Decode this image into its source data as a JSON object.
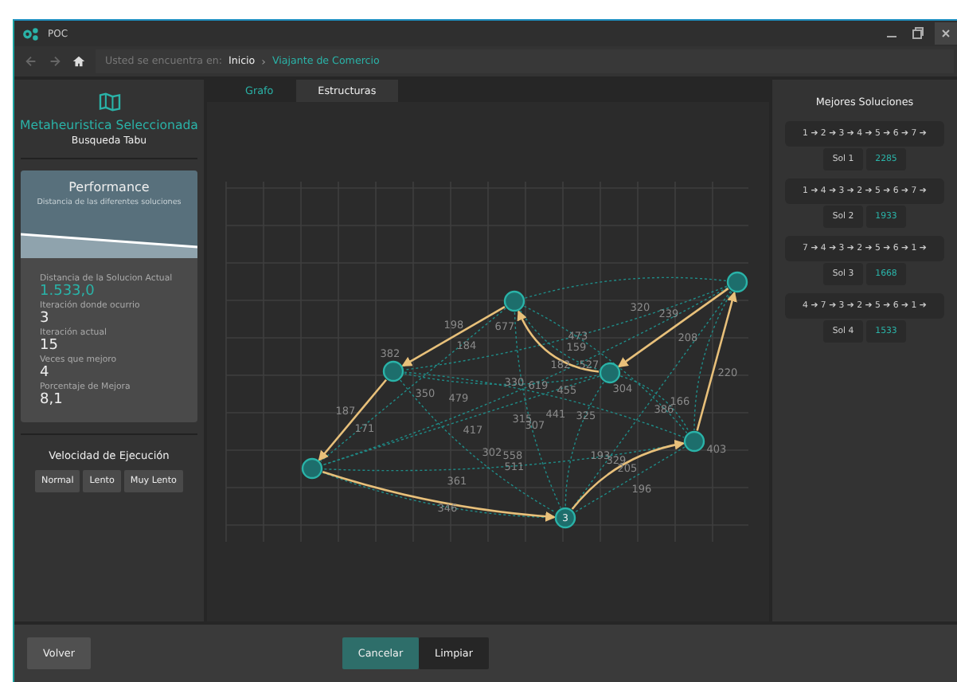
{
  "window": {
    "title": "POC"
  },
  "breadcrumb": {
    "prefix": "Usted se encuentra en:",
    "items": [
      {
        "label": "Inicio",
        "selected": false
      },
      {
        "label": "Viajante de Comercio",
        "selected": true
      }
    ],
    "separator": "›"
  },
  "sidebar": {
    "heading": "Metaheuristica Seleccionada",
    "subheading": "Busqueda Tabu",
    "performance": {
      "title": "Performance",
      "subtitle": "Distancia de las diferentes soluciones",
      "stats": [
        {
          "label": "Distancia de la Solucion Actual",
          "value": "1.533,0",
          "highlight": true
        },
        {
          "label": "Iteración donde ocurrio",
          "value": "3",
          "highlight": false
        },
        {
          "label": "Iteración actual",
          "value": "15",
          "highlight": false
        },
        {
          "label": "Veces que mejoro",
          "value": "4",
          "highlight": false
        },
        {
          "label": "Porcentaje de Mejora",
          "value": "8,1",
          "highlight": false
        }
      ]
    },
    "speed": {
      "title": "Velocidad de Ejecución",
      "buttons": [
        "Normal",
        "Lento",
        "Muy Lento"
      ]
    }
  },
  "tabs": [
    {
      "label": "Grafo",
      "selected": true
    },
    {
      "label": "Estructuras",
      "selected": false
    }
  ],
  "graph": {
    "node_label": "3",
    "edge_weights": [
      "198",
      "184",
      "677",
      "382",
      "320",
      "239",
      "473",
      "159",
      "208",
      "182",
      "527",
      "330",
      "619",
      "455",
      "304",
      "220",
      "350",
      "479",
      "187",
      "171",
      "166",
      "386",
      "315",
      "307",
      "441",
      "325",
      "417",
      "302",
      "558",
      "511",
      "193",
      "329",
      "205",
      "403",
      "196",
      "361",
      "346"
    ]
  },
  "solutions": {
    "title": "Mejores Soluciones",
    "items": [
      {
        "route": "1 ➔ 2 ➔ 3 ➔ 4 ➔ 5 ➔ 6 ➔ 7 ➔",
        "name": "Sol 1",
        "value": "2285"
      },
      {
        "route": "1 ➔ 4 ➔ 3 ➔ 2 ➔ 5 ➔ 6 ➔ 7 ➔",
        "name": "Sol 2",
        "value": "1933"
      },
      {
        "route": "7 ➔ 4 ➔ 3 ➔ 2 ➔ 5 ➔ 6 ➔ 1 ➔",
        "name": "Sol 3",
        "value": "1668"
      },
      {
        "route": "4 ➔ 7 ➔ 3 ➔ 2 ➔ 5 ➔ 6 ➔ 1 ➔",
        "name": "Sol 4",
        "value": "1533"
      }
    ]
  },
  "footer": [
    {
      "label": "Volver",
      "kind": "secondary"
    },
    {
      "label": "Cancelar",
      "kind": "primary"
    },
    {
      "label": "Limpiar",
      "kind": "dark"
    }
  ]
}
